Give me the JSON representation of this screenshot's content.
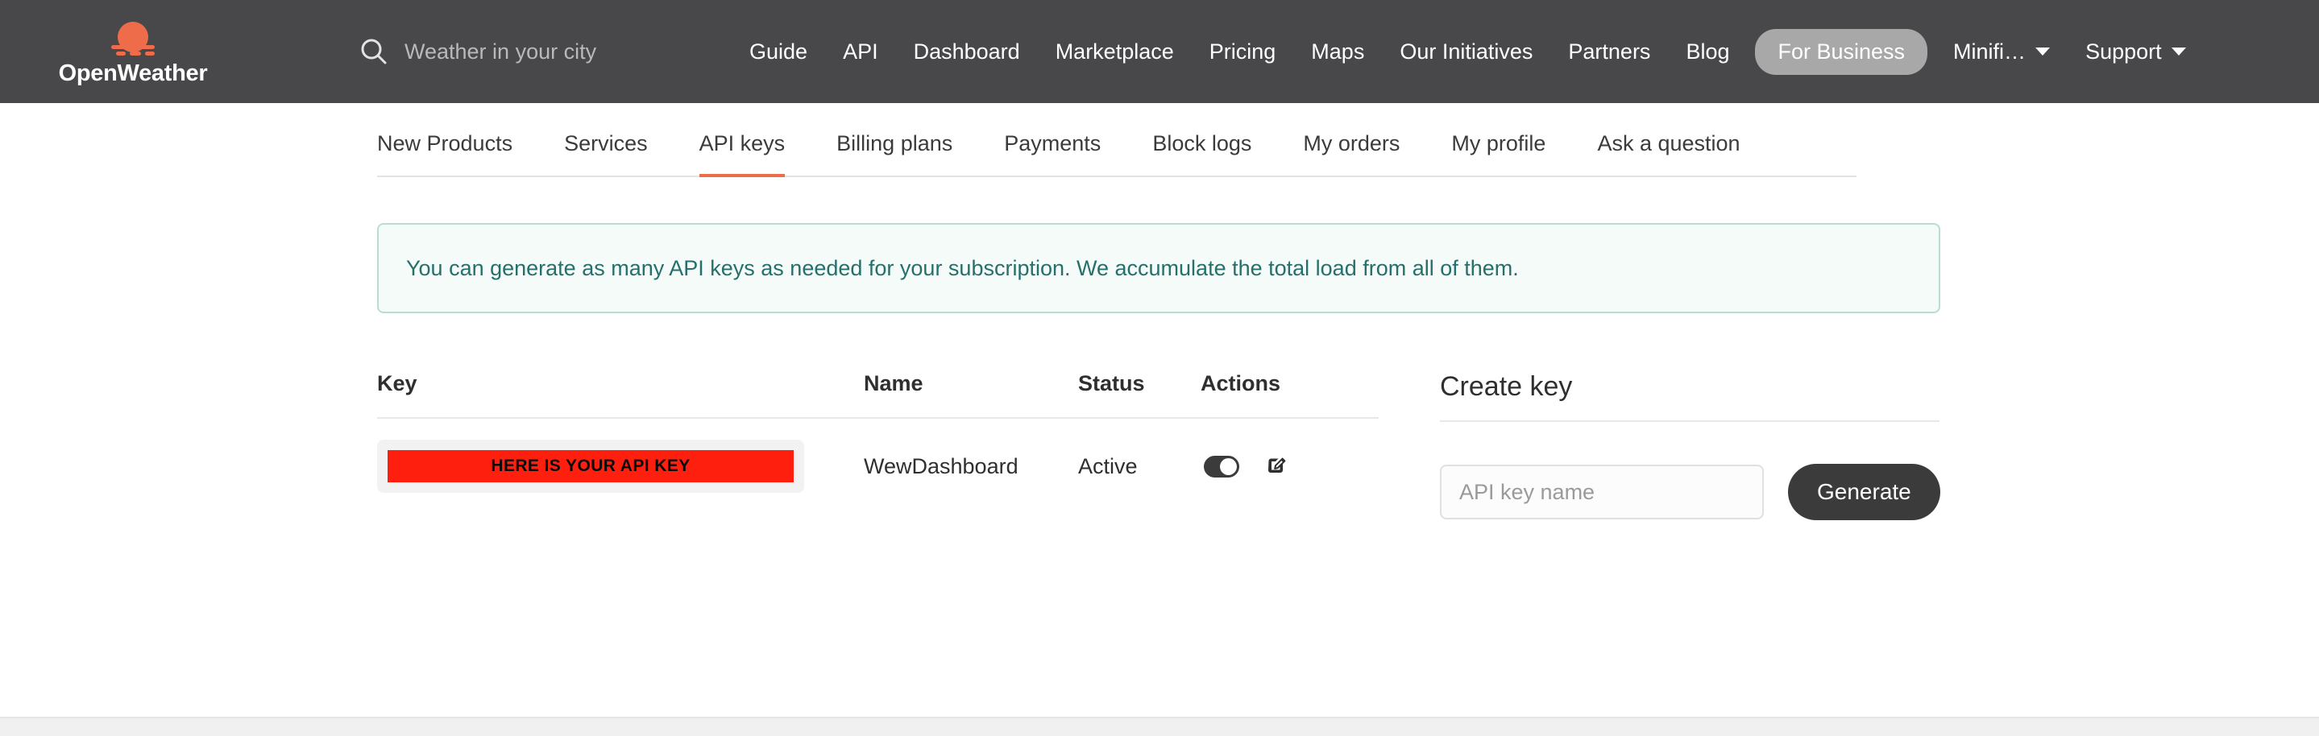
{
  "brand": {
    "name": "OpenWeather",
    "logo_icon": "sun-fog-icon",
    "logo_color": "#ef6c4b"
  },
  "search": {
    "icon": "search-icon",
    "placeholder": "Weather in your city",
    "value": ""
  },
  "topnav": {
    "links": [
      {
        "label": "Guide",
        "type": "link"
      },
      {
        "label": "API",
        "type": "link"
      },
      {
        "label": "Dashboard",
        "type": "link"
      },
      {
        "label": "Marketplace",
        "type": "link"
      },
      {
        "label": "Pricing",
        "type": "link"
      },
      {
        "label": "Maps",
        "type": "link"
      },
      {
        "label": "Our Initiatives",
        "type": "link"
      },
      {
        "label": "Partners",
        "type": "link"
      },
      {
        "label": "Blog",
        "type": "link"
      },
      {
        "label": "For Business",
        "type": "pill"
      },
      {
        "label": "Minifi…",
        "type": "dropdown"
      },
      {
        "label": "Support",
        "type": "dropdown"
      }
    ],
    "pill_bg": "#a8a8a8",
    "bar_bg": "#48484a"
  },
  "tabs": [
    {
      "label": "New Products",
      "active": false
    },
    {
      "label": "Services",
      "active": false
    },
    {
      "label": "API keys",
      "active": true
    },
    {
      "label": "Billing plans",
      "active": false
    },
    {
      "label": "Payments",
      "active": false
    },
    {
      "label": "Block logs",
      "active": false
    },
    {
      "label": "My orders",
      "active": false
    },
    {
      "label": "My profile",
      "active": false
    },
    {
      "label": "Ask a question",
      "active": false
    }
  ],
  "tab_active_color": "#eb6e4b",
  "banner": {
    "text": "You can generate as many API keys as needed for your subscription. We accumulate the total load from all of them.",
    "text_color": "#266f6b",
    "border_color": "#b9ddd4",
    "background": "#f4fbf9"
  },
  "keys_table": {
    "headers": {
      "key": "Key",
      "name": "Name",
      "status": "Status",
      "actions": "Actions"
    },
    "rows": [
      {
        "key_redacted_label": "HERE IS YOUR API KEY",
        "key_redacted_color": "#ff1f0f",
        "name": "WewDashboard",
        "status": "Active",
        "toggle_on": true,
        "toggle_icon": "toggle-on-icon",
        "edit_icon": "edit-pencil-icon"
      }
    ]
  },
  "create_key": {
    "title": "Create key",
    "input_placeholder": "API key name",
    "input_value": "",
    "generate_label": "Generate",
    "button_bg": "#3b3b3b"
  }
}
